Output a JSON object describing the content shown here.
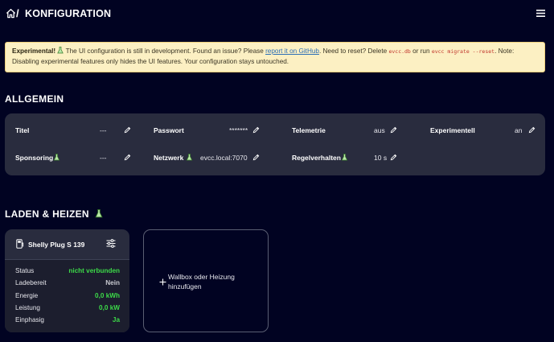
{
  "header": {
    "separator": "/",
    "title": "KONFIGURATION"
  },
  "banner": {
    "strong": "Experimental!",
    "text1": " The UI configuration is still in development. Found an issue? Please ",
    "link": "report it on GitHub",
    "text2": ". Need to reset? Delete ",
    "code1": "evcc.db",
    "text3": " or run ",
    "code2": "evcc migrate --reset",
    "text4": ". Note:",
    "line2": "Disabling experimental features only hides the UI features. Your configuration stays untouched."
  },
  "general": {
    "heading": "ALLGEMEIN",
    "items": [
      {
        "key": "Titel",
        "value": "---"
      },
      {
        "key": "Passwort",
        "value": "*******"
      },
      {
        "key": "Telemetrie",
        "value": "aus"
      },
      {
        "key": "Experimentell",
        "value": "an"
      },
      {
        "key": "Sponsoring",
        "value": "---"
      },
      {
        "key": "Netzwerk",
        "value": "evcc.local:7070"
      },
      {
        "key": "Regelverhalten",
        "value": "10 s"
      }
    ]
  },
  "loading": {
    "heading": "LADEN & HEIZEN",
    "charger": {
      "name": "Shelly Plug S 139",
      "rows": [
        {
          "label": "Status",
          "value": "nicht verbunden"
        },
        {
          "label": "Ladebereit",
          "value": "Nein"
        },
        {
          "label": "Energie",
          "value": "0,0 kWh"
        },
        {
          "label": "Leistung",
          "value": "0,0 kW"
        },
        {
          "label": "Einphasig",
          "value": "Ja"
        }
      ]
    },
    "add_label": "Wallbox oder Heizung hinzufügen"
  },
  "colors": {
    "background": "#010322",
    "card": "#292c3e",
    "accent_green": "#3cda48",
    "banner_bg": "#fcf0c3"
  }
}
